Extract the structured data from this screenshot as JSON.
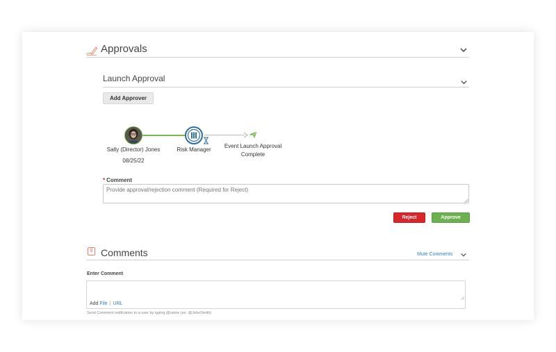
{
  "approvals": {
    "title": "Approvals",
    "icon": "pen-signature-icon",
    "launch": {
      "title": "Launch Approval",
      "add_approver_label": "Add Approver"
    },
    "flow": {
      "steps": [
        {
          "name": "Sally (Director) Jones",
          "date": "08/25/22",
          "status": "approved"
        },
        {
          "name": "Risk Manager",
          "status": "pending"
        },
        {
          "name_line1": "Event Launch Approval",
          "name_line2": "Complete",
          "status": "final"
        }
      ]
    },
    "comment": {
      "required_mark": "*",
      "label": "Comment",
      "placeholder": "Provide approval/rejection comment (Required for Reject)"
    },
    "reject_label": "Reject",
    "approve_label": "Approve"
  },
  "comments": {
    "badge_count": "0",
    "title": "Comments",
    "mute_label": "Mute Comments",
    "enter_label": "Enter Comment",
    "add_label": "Add",
    "file_label": "File",
    "separator": "|",
    "url_label": "URL",
    "hint": "Send Comment notification to a user by typing @name (ex. @JohnSmith)"
  },
  "colors": {
    "reject": "#d9262a",
    "approve": "#6bb14f",
    "link": "#2a7fc4",
    "node_ring": "#2d6f9f",
    "flow_done": "#7ab84f"
  }
}
